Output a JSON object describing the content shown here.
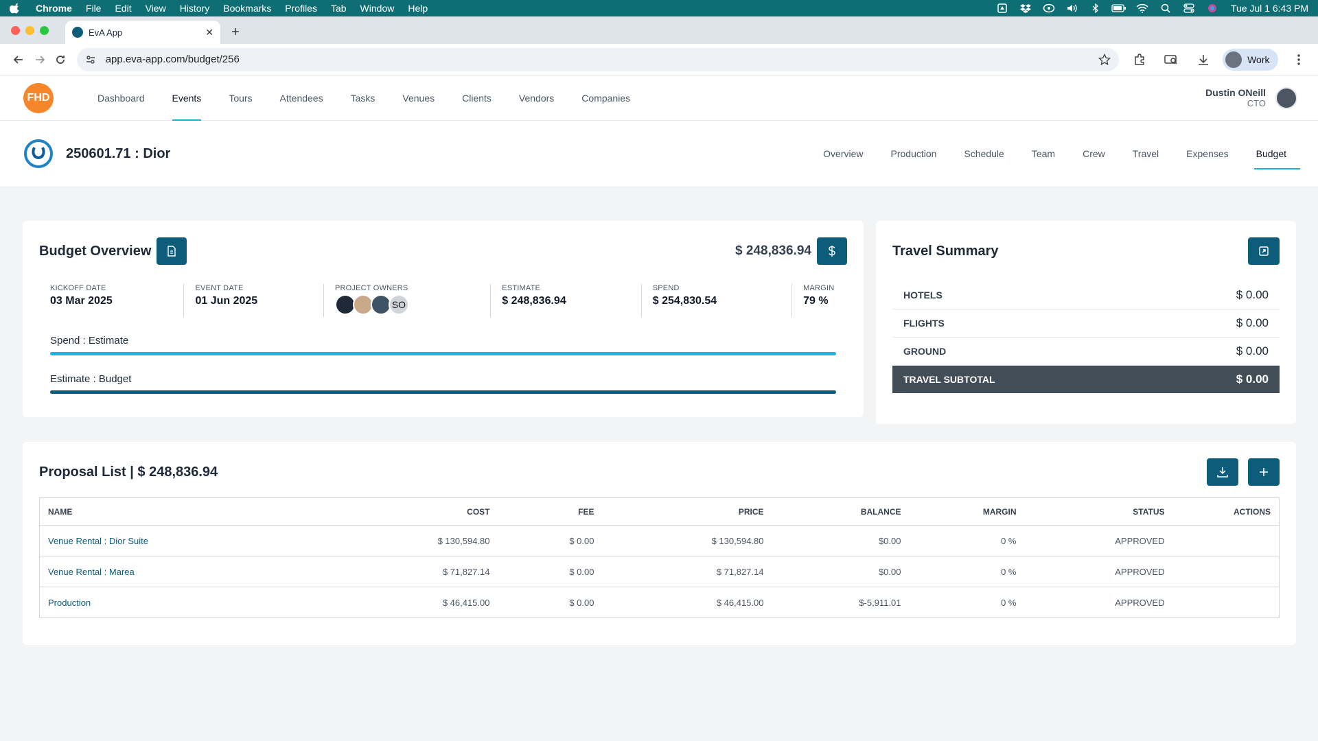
{
  "menubar": {
    "app": "Chrome",
    "items": [
      "File",
      "Edit",
      "View",
      "History",
      "Bookmarks",
      "Profiles",
      "Tab",
      "Window",
      "Help"
    ],
    "clock": "Tue Jul 1  6:43 PM"
  },
  "browser": {
    "tab_title": "EvA App",
    "url": "app.eva-app.com/budget/256",
    "profile": "Work"
  },
  "app": {
    "logo_text": "FHD",
    "nav": [
      "Dashboard",
      "Events",
      "Tours",
      "Attendees",
      "Tasks",
      "Venues",
      "Clients",
      "Vendors",
      "Companies"
    ],
    "active_nav": "Events",
    "user": {
      "name": "Dustin ONeill",
      "role": "CTO"
    }
  },
  "event": {
    "title": "250601.71 : Dior",
    "tabs": [
      "Overview",
      "Production",
      "Schedule",
      "Team",
      "Crew",
      "Travel",
      "Expenses",
      "Budget"
    ],
    "active_tab": "Budget"
  },
  "budget": {
    "title": "Budget Overview",
    "total": "$ 248,836.94",
    "kpis": {
      "kickoff_label": "KICKOFF DATE",
      "kickoff_value": "03 Mar 2025",
      "event_label": "EVENT DATE",
      "event_value": "01 Jun 2025",
      "owners_label": "PROJECT OWNERS",
      "owners_initials": "SO",
      "estimate_label": "ESTIMATE",
      "estimate_value": "$ 248,836.94",
      "spend_label": "SPEND",
      "spend_value": "$ 254,830.54",
      "margin_label": "MARGIN",
      "margin_value": "79 %"
    },
    "bars": [
      {
        "label": "Spend : Estimate",
        "fill": 1.0,
        "color": "#1fb2e6"
      },
      {
        "label": "Estimate : Budget",
        "fill": 1.0,
        "color": "#0d5c79"
      }
    ]
  },
  "travel": {
    "title": "Travel Summary",
    "rows": [
      {
        "label": "HOTELS",
        "amount": "$ 0.00"
      },
      {
        "label": "FLIGHTS",
        "amount": "$ 0.00"
      },
      {
        "label": "GROUND",
        "amount": "$ 0.00"
      }
    ],
    "subtotal_label": "TRAVEL SUBTOTAL",
    "subtotal_amount": "$ 0.00"
  },
  "proposal": {
    "title": "Proposal List | $ 248,836.94",
    "columns": [
      "NAME",
      "COST",
      "FEE",
      "PRICE",
      "BALANCE",
      "MARGIN",
      "STATUS",
      "ACTIONS"
    ],
    "rows": [
      [
        "Venue Rental : Dior Suite",
        "$ 130,594.80",
        "$ 0.00",
        "$ 130,594.80",
        "$0.00",
        "0 %",
        "APPROVED",
        ""
      ],
      [
        "Venue Rental : Marea",
        "$ 71,827.14",
        "$ 0.00",
        "$ 71,827.14",
        "$0.00",
        "0 %",
        "APPROVED",
        ""
      ],
      [
        "Production",
        "$ 46,415.00",
        "$ 0.00",
        "$ 46,415.00",
        "$-5,911.01",
        "0 %",
        "APPROVED",
        ""
      ]
    ]
  },
  "colors": {
    "accent": "#0d5c79",
    "underline": "#1fb2d6",
    "logo": "#f7862a",
    "subtotal_bg": "#434d57"
  }
}
